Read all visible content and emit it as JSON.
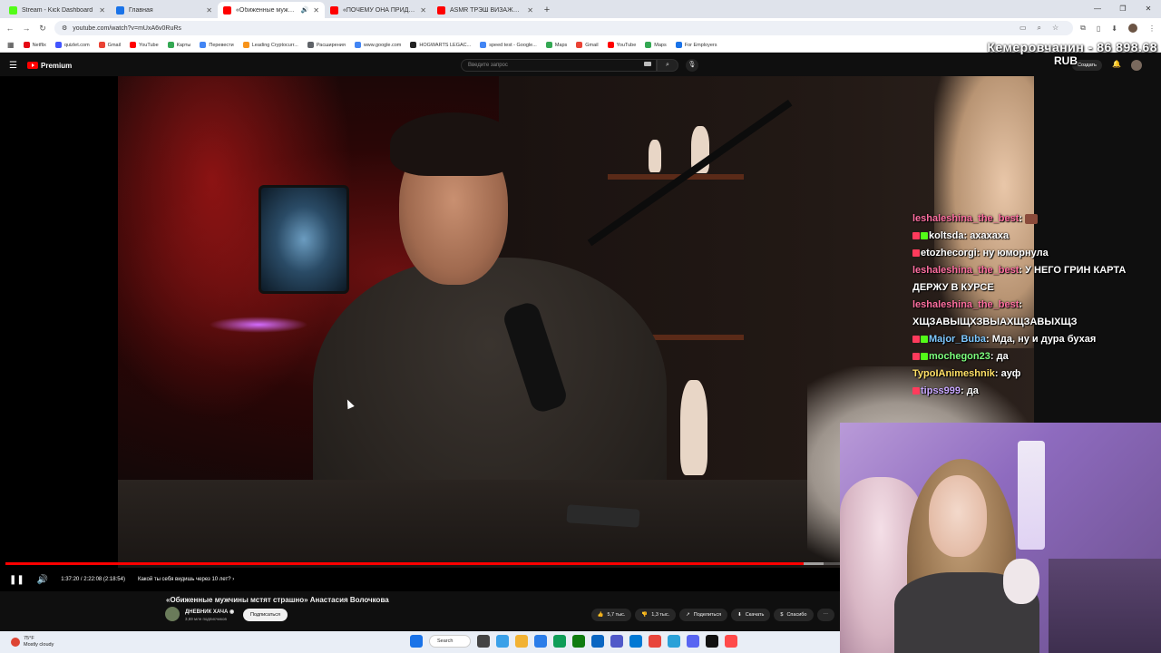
{
  "browser": {
    "tabs": [
      {
        "title": "Stream - Kick Dashboard",
        "favicon_color": "#53fc18",
        "active": false
      },
      {
        "title": "Главная",
        "favicon_color": "#1a73e8",
        "active": false
      },
      {
        "title": "«Обиженные мужчины м...",
        "favicon_color": "#ff0000",
        "active": true
      },
      {
        "title": "«ПОЧЕМУ ОНА ПРИДИРАЕТС...",
        "favicon_color": "#ff0000",
        "active": false
      },
      {
        "title": "ASMR ТРЭШ ВИЗАЖИСТ ДЕЛ...",
        "favicon_color": "#ff0000",
        "active": false
      }
    ],
    "url": "youtube.com/watch?v=mUxA6v0RuRs",
    "bookmarks": [
      {
        "label": "Netflix",
        "color": "#e50914"
      },
      {
        "label": "quizlet.com",
        "color": "#4255ff"
      },
      {
        "label": "Gmail",
        "color": "#ea4335"
      },
      {
        "label": "YouTube",
        "color": "#ff0000"
      },
      {
        "label": "Карты",
        "color": "#34a853"
      },
      {
        "label": "Перевести",
        "color": "#4285f4"
      },
      {
        "label": "Leading Cryptocurr...",
        "color": "#f7931a"
      },
      {
        "label": "Расширения",
        "color": "#5f6368"
      },
      {
        "label": "www.google.com",
        "color": "#4285f4"
      },
      {
        "label": "HOGWARTS LEGAC...",
        "color": "#222222"
      },
      {
        "label": "speed test - Google...",
        "color": "#4285f4"
      },
      {
        "label": "Maps",
        "color": "#34a853"
      },
      {
        "label": "Gmail",
        "color": "#ea4335"
      },
      {
        "label": "YouTube",
        "color": "#ff0000"
      },
      {
        "label": "Maps",
        "color": "#34a853"
      },
      {
        "label": "For Employers",
        "color": "#1a73e8"
      }
    ]
  },
  "overlay": {
    "ticker": "Кемеровчанин - 86 898.68",
    "currency": "RUB"
  },
  "youtube": {
    "brand": "Premium",
    "search_placeholder": "Введите запрос",
    "create_label": "Создать",
    "player": {
      "timecode": "1:37:20 / 2:22:08 (2:18:54)",
      "chapter": "Какой ты себя видишь через 10 лет? ›",
      "played_fraction": 0.78,
      "buffered_fraction": 0.8
    },
    "video": {
      "title": "«Обиженные мужчины мстят страшно» Анастасия Волочкова",
      "channel": "ДНЕВНИК ХАЧА",
      "subscribers": "3,69 млн подписчиков",
      "subscribe_label": "Подписаться",
      "likes": "5,7 тыс.",
      "dislikes": "1,3 тыс.",
      "share_label": "Поделиться",
      "download_label": "Скачать",
      "thanks_label": "Спасибо"
    }
  },
  "chat": [
    {
      "user": "leshaleshina_the_best",
      "user_color": "#ff6fa0",
      "text": "",
      "badges": [],
      "emote": true
    },
    {
      "user": "koltsda",
      "user_color": "#ffffff",
      "text": "ахахаха",
      "badges": [
        "#ff3b5c",
        "#53fc18"
      ],
      "emote": false
    },
    {
      "user": "etozhecorgi",
      "user_color": "#ffffff",
      "text": "ну юморнула",
      "badges": [
        "#ff3b5c"
      ],
      "emote": false
    },
    {
      "user": "leshaleshina_the_best",
      "user_color": "#ff6fa0",
      "text": "У НЕГО ГРИН КАРТА ДЕРЖУ В КУРСЕ",
      "badges": [],
      "emote": false
    },
    {
      "user": "leshaleshina_the_best",
      "user_color": "#ff6fa0",
      "text": "ХЩЗАВЫЩХЗВЫАХЩЗАВЫХЩЗ",
      "badges": [],
      "emote": false
    },
    {
      "user": "Major_Buba",
      "user_color": "#7ec8ff",
      "text": "Мда, ну и дура бухая",
      "badges": [
        "#ff3b5c",
        "#53fc18"
      ],
      "emote": false
    },
    {
      "user": "mochegon23",
      "user_color": "#7dff7d",
      "text": "да",
      "badges": [
        "#ff3b5c",
        "#53fc18"
      ],
      "emote": false
    },
    {
      "user": "TypoIAnimeshnik",
      "user_color": "#ffe066",
      "text": "ауф",
      "badges": [],
      "emote": false
    },
    {
      "user": "tipss999",
      "user_color": "#c8a7ff",
      "text": "да",
      "badges": [
        "#ff3b5c"
      ],
      "emote": false
    }
  ],
  "taskbar": {
    "temperature": "75°F",
    "condition": "Mostly cloudy",
    "search_label": "Search"
  }
}
